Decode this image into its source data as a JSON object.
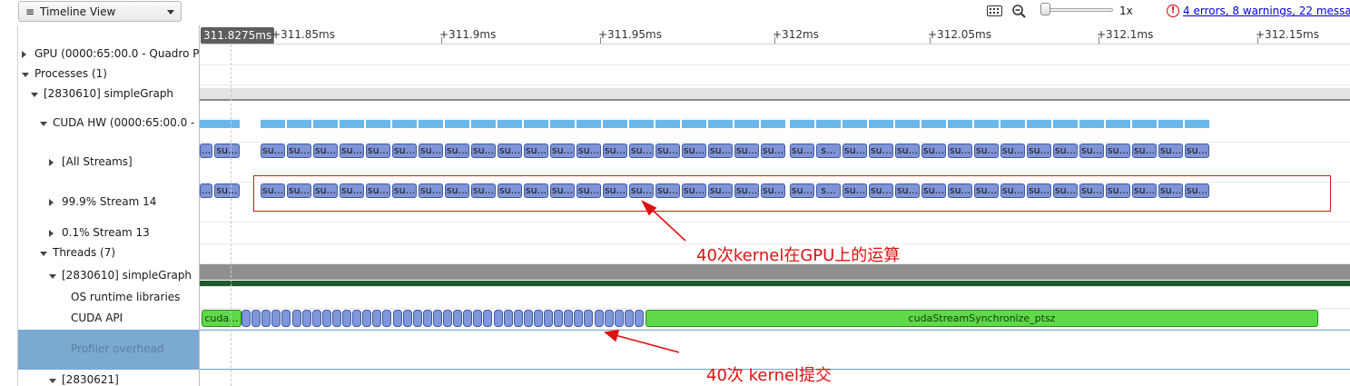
{
  "toolbar": {
    "view_menu_icon": "hamburger-icon",
    "view_label": "Timeline View",
    "keyboard_icon": "keyboard-icon",
    "zoom_icon": "zoom-out-icon",
    "zoom_level": "1x",
    "zoom_value": 0,
    "error_icon": "error-icon",
    "errors_link": "4 errors, 8 warnings, 22 messa"
  },
  "ruler": {
    "origin": "0s",
    "cursor_time": "311.8275ms",
    "ticks": [
      "+311.85ms",
      "+311.9ms",
      "+311.95ms",
      "+312ms",
      "+312.05ms",
      "+312.1ms",
      "+312.15ms"
    ]
  },
  "tree": [
    {
      "label": "GPU (0000:65:00.0 - Quadro P",
      "expander": "right"
    },
    {
      "label": "Processes (1)",
      "expander": "down"
    },
    {
      "label": "[2830610] simpleGraph",
      "expander": "down"
    },
    {
      "label": "CUDA HW (0000:65:00.0 -",
      "expander": "down"
    },
    {
      "label": "[All Streams]",
      "expander": "right"
    },
    {
      "label": "99.9% Stream 14",
      "expander": "right"
    },
    {
      "label": "0.1% Stream 13",
      "expander": "right"
    },
    {
      "label": "Threads (7)",
      "expander": "down"
    },
    {
      "label": "[2830610] simpleGraph",
      "expander": "down"
    },
    {
      "label": "OS runtime libraries",
      "expander": ""
    },
    {
      "label": "CUDA API",
      "expander": ""
    },
    {
      "label": "Profiler overhead",
      "expander": ""
    },
    {
      "label": "[2830621]",
      "expander": "down"
    }
  ],
  "kernels": {
    "first_row_labels": [
      "...",
      "su..."
    ],
    "labels": [
      "su...",
      "su...",
      "su...",
      "su...",
      "su...",
      "su...",
      "su...",
      "su...",
      "su...",
      "su...",
      "su...",
      "su...",
      "su...",
      "su...",
      "su...",
      "su...",
      "su...",
      "su...",
      "su...",
      "su...",
      "su...",
      "s...",
      "su...",
      "su...",
      "su...",
      "su...",
      "su...",
      "su...",
      "su...",
      "su...",
      "su...",
      "su...",
      "su...",
      "su...",
      "su...",
      "su..."
    ]
  },
  "cuda_api": {
    "first_call": "cuda...",
    "launch_count": 40,
    "sync_call": "cudaStreamSynchronize_ptsz"
  },
  "annotations": {
    "gpu_note": "40次kernel在GPU上的运算",
    "launch_note": "40次 kernel提交"
  },
  "colors": {
    "kernel": "#7f94d6",
    "hw_activity": "#6cb7ea",
    "sync_call": "#5ed94a",
    "annotation": "#e01010",
    "profiler_overhead": "#7aa9d2"
  }
}
